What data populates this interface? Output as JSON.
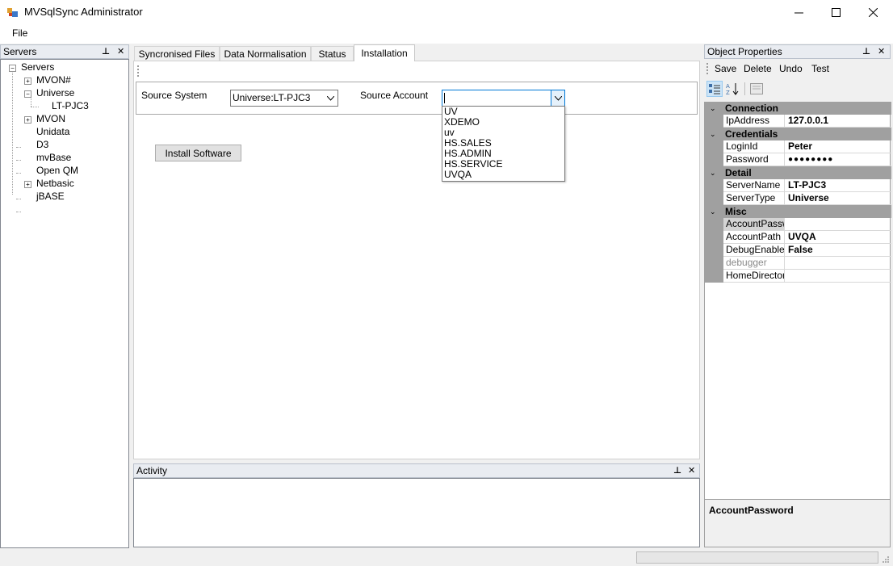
{
  "window": {
    "title": "MVSqlSync Administrator"
  },
  "menu": {
    "file": "File"
  },
  "servers": {
    "header": "Servers",
    "tree": {
      "root": "Servers",
      "items": [
        "MVON#",
        "Universe",
        "LT-PJC3",
        "MVON",
        "Unidata",
        "D3",
        "mvBase",
        "Open QM",
        "Netbasic",
        "jBASE"
      ]
    }
  },
  "tabs": [
    "Syncronised Files",
    "Data Normalisation",
    "Status",
    "Installation"
  ],
  "installation": {
    "source_system_label": "Source System",
    "source_system_value": "Universe:LT-PJC3",
    "source_account_label": "Source Account",
    "source_account_value": "",
    "account_options": [
      "UV",
      "XDEMO",
      "uv",
      "HS.SALES",
      "HS.ADMIN",
      "HS.SERVICE",
      "UVQA"
    ],
    "install_button": "Install Software"
  },
  "activity": {
    "header": "Activity"
  },
  "properties": {
    "header": "Object Properties",
    "toolbar": {
      "save": "Save",
      "delete": "Delete",
      "undo": "Undo",
      "test": "Test"
    },
    "categories": {
      "connection": "Connection",
      "credentials": "Credentials",
      "detail": "Detail",
      "misc": "Misc"
    },
    "rows": {
      "ip_name": "IpAddress",
      "ip_value": "127.0.0.1",
      "login_name": "LoginId",
      "login_value": "Peter",
      "pwd_name": "Password",
      "pwd_value": "●●●●●●●●",
      "server_name": "ServerName",
      "server_value": "LT-PJC3",
      "type_name": "ServerType",
      "type_value": "Universe",
      "acctpwd_name": "AccountPassword",
      "acctpwd_value": "",
      "acctpath_name": "AccountPath",
      "acctpath_value": "UVQA",
      "debug_name": "DebugEnabled",
      "debug_value": "False",
      "debugger_name": "debugger",
      "debugger_value": "",
      "home_name": "HomeDirectory",
      "home_value": ""
    },
    "description_title": "AccountPassword"
  },
  "colors": {
    "category_bg": "#a0a0a0",
    "panel_header": "#e9ecf1"
  }
}
